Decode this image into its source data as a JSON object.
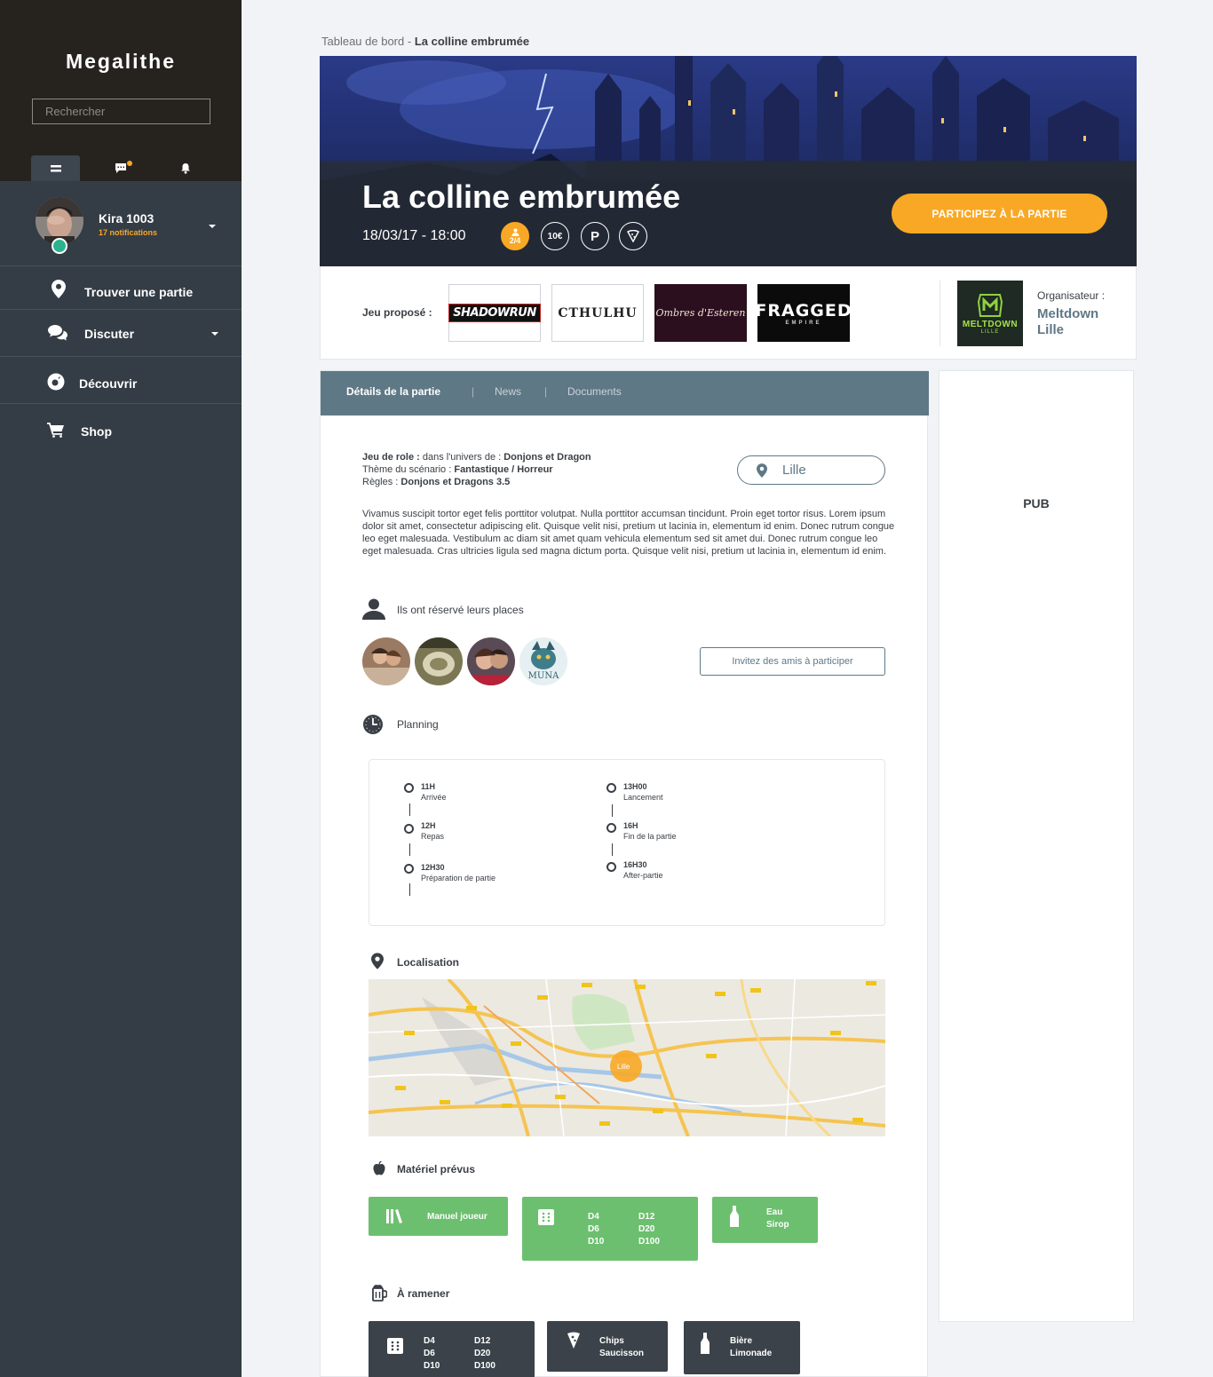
{
  "app": {
    "name": "Megalithe"
  },
  "sidebar": {
    "search_placeholder": "Rechercher",
    "tabs": [
      {
        "icon": "menu-icon",
        "active": true
      },
      {
        "icon": "chat-icon",
        "badge": true
      },
      {
        "icon": "bell-icon"
      }
    ],
    "profile": {
      "name": "Kira 1003",
      "notifications": "17 notifications"
    },
    "nav": [
      {
        "label": "Trouver une partie",
        "icon": "map-pin-icon"
      },
      {
        "label": "Discuter",
        "icon": "chat-bubbles-icon",
        "has_dropdown": true
      },
      {
        "label": "Découvrir",
        "icon": "compass-icon"
      },
      {
        "label": "Shop",
        "icon": "cart-icon"
      }
    ]
  },
  "breadcrumb": {
    "root": "Tableau de bord",
    "separator": " - ",
    "current": "La colline embrumée"
  },
  "hero": {
    "title": "La colline embrumée",
    "datetime": "18/03/17 - 18:00",
    "chips": [
      "2/4",
      "10€",
      "P",
      "pizza"
    ],
    "cta": "PARTICIPEZ À LA PARTIE",
    "accent": "#f9a825"
  },
  "games": {
    "label": "Jeu proposé :",
    "list": [
      "SHADOWRUN",
      "CTHULHU",
      "Ombres d'Esteren",
      "FRAGGED"
    ],
    "list_sub": [
      "",
      "",
      "",
      "EMPIRE"
    ],
    "organizer_label": "Organisateur :",
    "organizer_name_1": "Meltdown",
    "organizer_name_2": "Lille",
    "organizer_logo_text": "MELTDOWN",
    "organizer_logo_sub": "LILLE"
  },
  "tabs": [
    "Détails de la partie",
    "News",
    "Documents"
  ],
  "details": {
    "line1_label": "Jeu de role :",
    "line1_mid": " dans l'univers de : ",
    "line1_value": "Donjons et Dragon",
    "line2_label": "Thème du scénario :",
    "line2_value": "Fantastique / Horreur",
    "line3_label": "Règles :",
    "line3_value": "Donjons et Dragons 3.5",
    "location": "Lille",
    "description": "Vivamus suscipit tortor eget felis porttitor volutpat. Nulla porttitor accumsan tincidunt. Proin eget tortor risus. Lorem ipsum dolor sit amet, consectetur adipiscing elit. Quisque velit nisi, pretium ut lacinia in, elementum id enim. Donec rutrum congue leo eget malesuada. Vestibulum ac diam sit amet quam vehicula elementum sed sit amet dui. Donec rutrum congue leo eget malesuada. Cras ultricies ligula sed magna dictum porta. Quisque velit nisi, pretium ut lacinia in, elementum id enim."
  },
  "participants": {
    "title": "Ils ont réservé leurs places",
    "invite": "Invitez des amis à participer",
    "avatar_caption": "MUNA"
  },
  "planning": {
    "title": "Planning",
    "left": [
      {
        "time": "11H",
        "label": "Arrivée"
      },
      {
        "time": "12H",
        "label": "Repas"
      },
      {
        "time": "12H30",
        "label": "Préparation de partie"
      }
    ],
    "right": [
      {
        "time": "13H00",
        "label": "Lancement"
      },
      {
        "time": "16H",
        "label": "Fin de la partie"
      },
      {
        "time": "16H30",
        "label": "After-partie"
      }
    ]
  },
  "localisation": {
    "title": "Localisation",
    "marker": "Lille"
  },
  "materiel": {
    "title": "Matériel prévus",
    "items": [
      {
        "icon": "books-icon",
        "lines": [
          "Manuel joueur"
        ]
      },
      {
        "icon": "dice-icon",
        "col1": [
          "D4",
          "D6",
          "D10"
        ],
        "col2": [
          "D12",
          "D20",
          "D100"
        ]
      },
      {
        "icon": "bottle-icon",
        "lines": [
          "Eau",
          "Sirop"
        ]
      }
    ],
    "color": "#6cbf6f"
  },
  "ramener": {
    "title": "À ramener",
    "items": [
      {
        "icon": "dice-icon",
        "col1": [
          "D4",
          "D6",
          "D10"
        ],
        "col2": [
          "D12",
          "D20",
          "D100"
        ]
      },
      {
        "icon": "pizza-icon",
        "lines": [
          "Chips",
          "Saucisson"
        ]
      },
      {
        "icon": "bottle-icon",
        "lines": [
          "Bière",
          "Limonade"
        ]
      }
    ],
    "color": "#3b4249"
  },
  "ad": {
    "label": "PUB"
  }
}
